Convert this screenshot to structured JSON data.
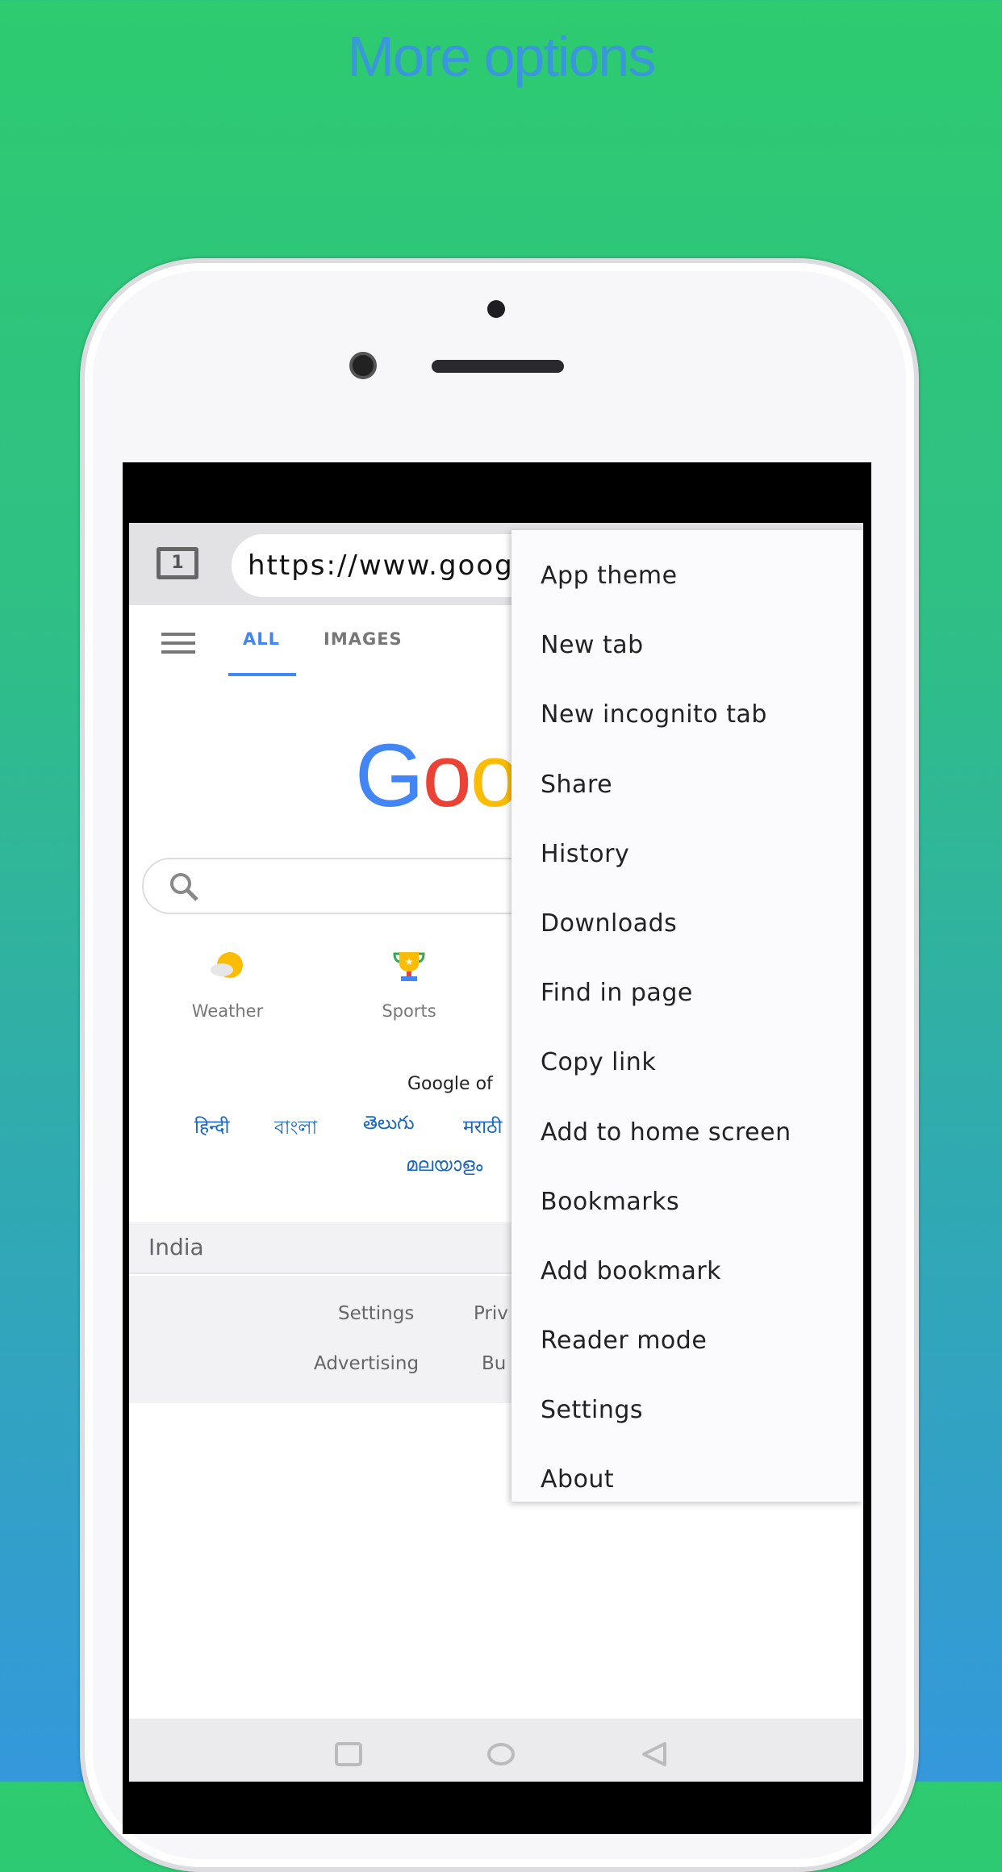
{
  "caption": "More options",
  "browser": {
    "tab_count": "1",
    "url": "https://www.google.com",
    "tabs": [
      {
        "label": "ALL",
        "active": true
      },
      {
        "label": "IMAGES",
        "active": false
      }
    ],
    "logo": "Google",
    "quick_links": [
      {
        "label": "Weather",
        "icon": "weather-icon"
      },
      {
        "label": "Sports",
        "icon": "trophy-icon"
      }
    ],
    "offered_in": "Google of",
    "languages": [
      "हिन्दी",
      "বাংলা",
      "తెలుగు",
      "मराठी",
      "മലയാളം"
    ],
    "region": "India",
    "footer_links": [
      "Settings",
      "Priv",
      "Advertising",
      "Bu"
    ]
  },
  "menu": {
    "items": [
      "App theme",
      "New tab",
      "New incognito tab",
      "Share",
      "History",
      "Downloads",
      "Find in page",
      "Copy link",
      "Add to home screen",
      "Bookmarks",
      "Add bookmark",
      "Reader mode",
      "Settings",
      "About"
    ]
  },
  "colors": {
    "accent": "#4285f4",
    "caption": "#3a96dd",
    "bg_top": "#2ecb70",
    "bg_bottom": "#3498db"
  }
}
